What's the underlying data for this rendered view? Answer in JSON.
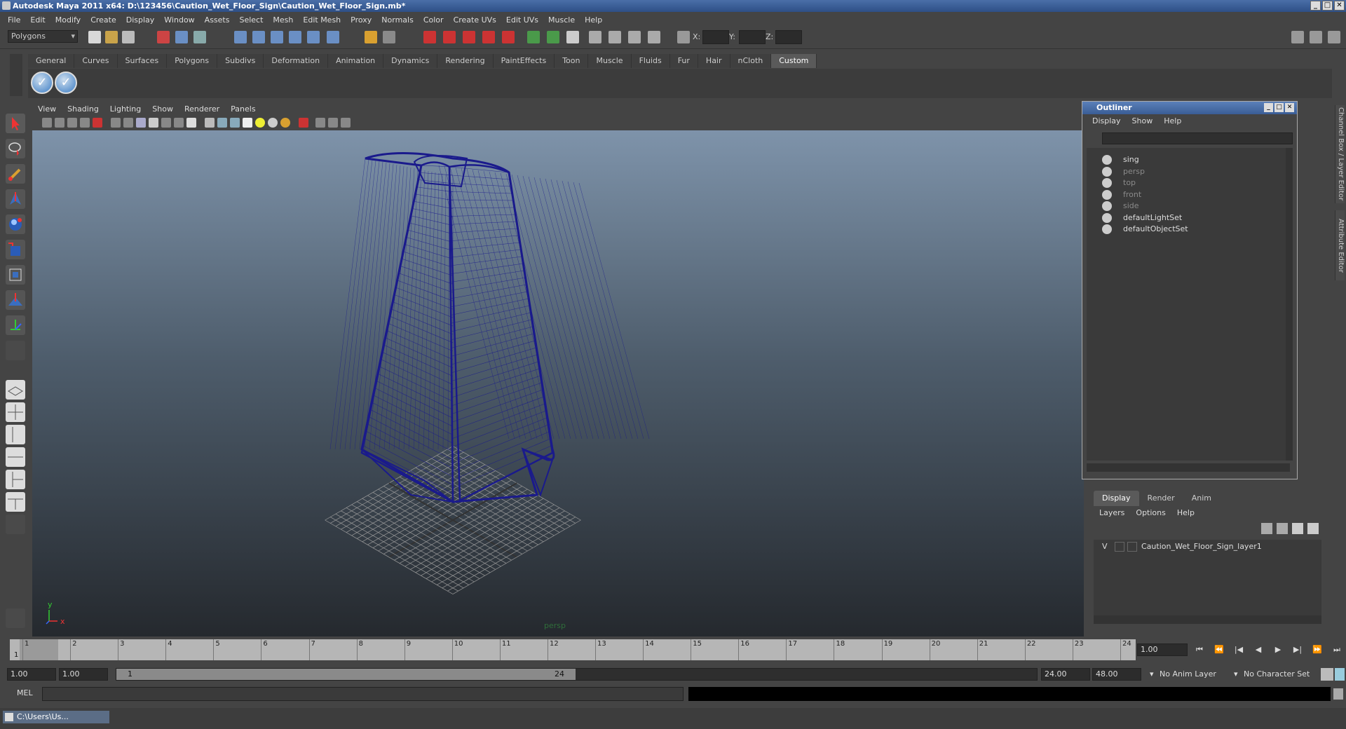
{
  "window": {
    "title": "Autodesk Maya 2011 x64: D:\\123456\\Caution_Wet_Floor_Sign\\Caution_Wet_Floor_Sign.mb*"
  },
  "menubar": [
    "File",
    "Edit",
    "Modify",
    "Create",
    "Display",
    "Window",
    "Assets",
    "Select",
    "Mesh",
    "Edit Mesh",
    "Proxy",
    "Normals",
    "Color",
    "Create UVs",
    "Edit UVs",
    "Muscle",
    "Help"
  ],
  "statusline": {
    "mode": "Polygons",
    "x_label": "X:",
    "y_label": "Y:",
    "z_label": "Z:"
  },
  "shelf": {
    "tabs": [
      "General",
      "Curves",
      "Surfaces",
      "Polygons",
      "Subdivs",
      "Deformation",
      "Animation",
      "Dynamics",
      "Rendering",
      "PaintEffects",
      "Toon",
      "Muscle",
      "Fluids",
      "Fur",
      "Hair",
      "nCloth",
      "Custom"
    ],
    "active_tab": "Custom"
  },
  "viewport": {
    "menu": [
      "View",
      "Shading",
      "Lighting",
      "Show",
      "Renderer",
      "Panels"
    ],
    "camera_label": "persp",
    "axis_y": "y",
    "axis_x": "x",
    "wire_color": "#1a1a8c",
    "grid_color": "#9a9a9a"
  },
  "outliner": {
    "title": "Outliner",
    "menu": [
      "Display",
      "Show",
      "Help"
    ],
    "items": [
      {
        "label": "sing",
        "dim": false
      },
      {
        "label": "persp",
        "dim": true
      },
      {
        "label": "top",
        "dim": true
      },
      {
        "label": "front",
        "dim": true
      },
      {
        "label": "side",
        "dim": true
      },
      {
        "label": "defaultLightSet",
        "dim": false
      },
      {
        "label": "defaultObjectSet",
        "dim": false
      }
    ]
  },
  "layer_editor": {
    "tabs": [
      "Display",
      "Render",
      "Anim"
    ],
    "active_tab": "Display",
    "menu": [
      "Layers",
      "Options",
      "Help"
    ],
    "layer": {
      "visible": "V",
      "name": "Caution_Wet_Floor_Sign_layer1"
    }
  },
  "side_tabs": {
    "channel_box": "Channel Box / Layer Editor",
    "attribute_editor": "Attribute Editor"
  },
  "timeline": {
    "ticks": [
      "1",
      "2",
      "3",
      "4",
      "5",
      "6",
      "7",
      "8",
      "9",
      "10",
      "11",
      "12",
      "13",
      "14",
      "15",
      "16",
      "17",
      "18",
      "19",
      "20",
      "21",
      "22",
      "23",
      "24"
    ],
    "current_frame": "1.00",
    "current_marker": "1"
  },
  "range": {
    "start": "1.00",
    "start_inner": "1.00",
    "thumb_start": "1",
    "thumb_end": "24",
    "end_inner": "24.00",
    "end": "48.00",
    "anim_layer": "No Anim Layer",
    "char_set": "No Character Set"
  },
  "command_line": {
    "label": "MEL"
  },
  "taskbar": {
    "item": "C:\\Users\\Us..."
  }
}
